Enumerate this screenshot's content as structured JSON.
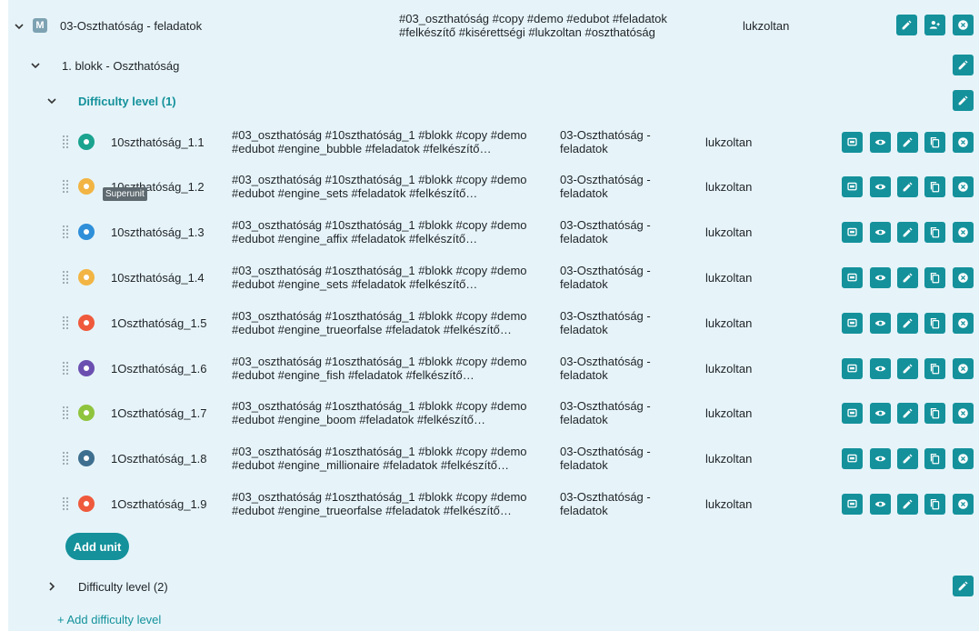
{
  "module": {
    "badge": "M",
    "title": "03-Oszthatóság - feladatok",
    "tags_line1": "#03_oszthatóság #copy #demo #edubot #feladatok",
    "tags_line2": "#felkészítő #kisérettségi #lukzoltan #oszthatóság",
    "owner": "lukzoltan"
  },
  "block": {
    "title": "1. blokk - Oszthatóság"
  },
  "difficulty1": {
    "title": "Difficulty level (1)"
  },
  "difficulty2": {
    "title": "Difficulty level (2)"
  },
  "tooltip": "Superunit",
  "add_unit_label": "Add unit",
  "add_difficulty_label": "+ Add difficulty level",
  "colors": {
    "accent": "#14919b",
    "panel": "#e6f4f9"
  },
  "units": [
    {
      "name": "10szthatóság_1.1",
      "tags1": "#03_oszthatóság #10szthatóság_1 #blokk #copy #demo",
      "tags2": "#edubot #engine_bubble #feladatok #felkészítő…",
      "module1": "03-Oszthatóság -",
      "module2": "feladatok",
      "owner": "lukzoltan",
      "icon": "bubble-engine-icon",
      "color": "#1aa38f"
    },
    {
      "name": "10szthatóság_1.2",
      "tags1": "#03_oszthatóság #10szthatóság_1 #blokk #copy #demo",
      "tags2": "#edubot #engine_sets #feladatok #felkészítő…",
      "module1": "03-Oszthatóság -",
      "module2": "feladatok",
      "owner": "lukzoltan",
      "icon": "sets-engine-icon",
      "color": "#f2b544"
    },
    {
      "name": "10szthatóság_1.3",
      "tags1": "#03_oszthatóság #10szthatóság_1 #blokk #copy #demo",
      "tags2": "#edubot #engine_affix #feladatok #felkészítő…",
      "module1": "03-Oszthatóság -",
      "module2": "feladatok",
      "owner": "lukzoltan",
      "icon": "affix-engine-icon",
      "color": "#2f8fd9"
    },
    {
      "name": "10szthatóság_1.4",
      "tags1": "#03_oszthatóság #1oszthatóság_1 #blokk #copy #demo",
      "tags2": "#edubot #engine_sets #feladatok #felkészítő…",
      "module1": "03-Oszthatóság -",
      "module2": "feladatok",
      "owner": "lukzoltan",
      "icon": "sets-engine-icon",
      "color": "#f2b544"
    },
    {
      "name": "1Oszthatóság_1.5",
      "tags1": "#03_oszthatóság #1oszthatóság_1 #blokk #copy #demo",
      "tags2": "#edubot #engine_trueorfalse #feladatok #felkészítő…",
      "module1": "03-Oszthatóság -",
      "module2": "feladatok",
      "owner": "lukzoltan",
      "icon": "trueorfalse-engine-icon",
      "color": "#ef5a3c"
    },
    {
      "name": "1Oszthatóság_1.6",
      "tags1": "#03_oszthatóság #1oszthatóság_1 #blokk #copy #demo",
      "tags2": "#edubot #engine_fish #feladatok #felkészítő…",
      "module1": "03-Oszthatóság -",
      "module2": "feladatok",
      "owner": "lukzoltan",
      "icon": "fish-engine-icon",
      "color": "#6b4fb0"
    },
    {
      "name": "1Oszthatóság_1.7",
      "tags1": "#03_oszthatóság #1oszthatóság_1 #blokk #copy #demo",
      "tags2": "#edubot #engine_boom #feladatok #felkészítő…",
      "module1": "03-Oszthatóság -",
      "module2": "feladatok",
      "owner": "lukzoltan",
      "icon": "boom-engine-icon",
      "color": "#8fc43d"
    },
    {
      "name": "1Oszthatóság_1.8",
      "tags1": "#03_oszthatóság #1oszthatóság_1 #blokk #copy #demo",
      "tags2": "#edubot #engine_millionaire #feladatok #felkészítő…",
      "module1": "03-Oszthatóság -",
      "module2": "feladatok",
      "owner": "lukzoltan",
      "icon": "millionaire-engine-icon",
      "color": "#3e6f8f"
    },
    {
      "name": "1Oszthatóság_1.9",
      "tags1": "#03_oszthatóság #1oszthatóság_1 #blokk #copy #demo",
      "tags2": "#edubot #engine_trueorfalse #feladatok #felkészítő…",
      "module1": "03-Oszthatóság -",
      "module2": "feladatok",
      "owner": "lukzoltan",
      "icon": "trueorfalse-engine-icon",
      "color": "#ef5a3c"
    }
  ]
}
